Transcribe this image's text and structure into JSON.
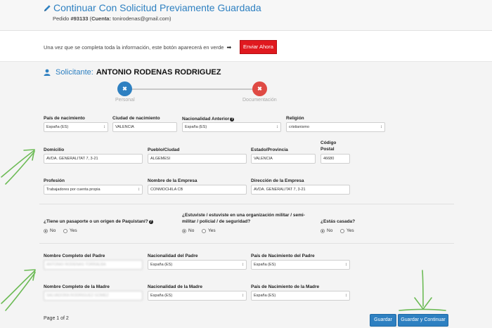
{
  "header": {
    "title": "Continuar Con Solicitud Previamente Guardada",
    "order_prefix": "Pedido ",
    "order_number": "#93133",
    "account_open": " (",
    "account_label": "Cuenta:",
    "account_email": " tonirodenas@gmail.com)"
  },
  "notice": {
    "text": "Una vez que se completa toda la información, este botón aparecerá en verde",
    "arrow": "➡",
    "send_label": "Enviar Ahora"
  },
  "applicant": {
    "label": "Solicitante:",
    "name": "ANTONIO RODENAS RODRIGUEZ"
  },
  "steps": [
    {
      "icon": "✖",
      "label": "Personal",
      "color": "#2e80c1"
    },
    {
      "icon": "✖",
      "label": "Documentación",
      "color": "#df4a44"
    }
  ],
  "fields": {
    "birth_country": {
      "label": "País de nacimiento",
      "value": "España (ES)"
    },
    "birth_city": {
      "label": "Ciudad de nacimiento",
      "value": "VALENCIA"
    },
    "prev_nationality": {
      "label": "Nacionalidad Anterior",
      "value": "España (ES)"
    },
    "religion": {
      "label": "Religión",
      "value": "cristianismo"
    },
    "address": {
      "label": "Domicilio",
      "value": "AVDA. GENERALITAT 7, 3-21"
    },
    "town": {
      "label": "Pueblo/Ciudad",
      "value": "ALGEMESI"
    },
    "state": {
      "label": "Estado/Provincia",
      "value": "VALENCIA"
    },
    "postal": {
      "label_1": "Código",
      "label_2": "Postal",
      "value": "46680"
    },
    "profession": {
      "label": "Profesión",
      "value": "Trabajadores por cuenta propia"
    },
    "company": {
      "label": "Nombre de la Empresa",
      "value": "CONMOCHILA CB"
    },
    "company_address": {
      "label": "Dirección de la Empresa",
      "value": "AVDA. GENERALITAT 7, 3-21"
    },
    "father_name": {
      "label": "Nombre Completo del Padre",
      "value": "ANTONIO RODENAS TORRALBA"
    },
    "father_nationality": {
      "label": "Nacionalidad del Padre",
      "value": "España (ES)"
    },
    "father_birth_country": {
      "label": "País de Nacimiento del Padre",
      "value": "España (ES)"
    },
    "mother_name": {
      "label": "Nombre Completo de la Madre",
      "value": "SALVADORA RODRIGUEZ GOMEZ"
    },
    "mother_nationality": {
      "label": "Nacionalidad de la Madre",
      "value": "España (ES)"
    },
    "mother_birth_country": {
      "label": "País de Nacimiento de la Madre",
      "value": "España (ES)"
    }
  },
  "questions": {
    "pakistan": {
      "text": "¿Tiene un pasaporte o un origen de Paquistaní?",
      "help": "?"
    },
    "military": {
      "line_1": "¿Estuviste / estuviste en una organización militar / semi-",
      "line_2": "militar / policial / de seguridad?"
    },
    "married": {
      "text": "¿Estás casada?"
    },
    "yes": "Yes",
    "no": "No"
  },
  "footer": {
    "pager": "Page 1 of 2",
    "save_label": "Guardar",
    "save_continue_label": "Guardar y Continuar"
  },
  "colors": {
    "accent": "#2e80c1",
    "danger": "#e0191f",
    "annotation": "#6dbb56"
  }
}
